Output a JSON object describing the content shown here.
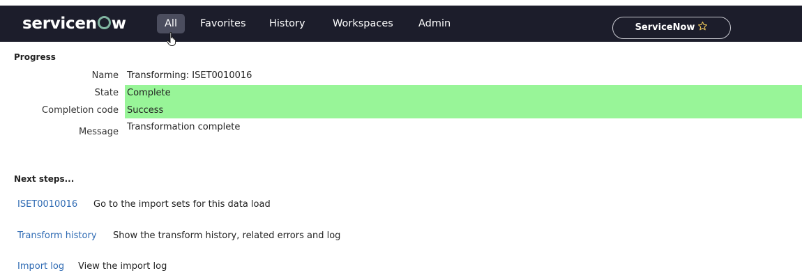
{
  "navbar": {
    "logo_text_pre": "servicen",
    "logo_text_post": "w",
    "items": [
      {
        "label": "All"
      },
      {
        "label": "Favorites"
      },
      {
        "label": "History"
      },
      {
        "label": "Workspaces"
      },
      {
        "label": "Admin"
      }
    ],
    "instance_label": "ServiceNow",
    "instance_icon": "star-icon",
    "colors": {
      "background": "#1c1d2b",
      "active_item": "#4b4d5e",
      "logo_accent": "#81b5a1"
    }
  },
  "progress": {
    "title": "Progress",
    "rows": [
      {
        "label": "Name",
        "value": "Transforming: ISET0010016"
      },
      {
        "label": "State",
        "value": "Complete",
        "highlight": "#98f598"
      },
      {
        "label": "Completion code",
        "value": "Success",
        "highlight": "#98f598"
      },
      {
        "label": "Message",
        "value": "Transformation complete"
      }
    ]
  },
  "next_steps": {
    "title": "Next steps...",
    "items": [
      {
        "link": "ISET0010016",
        "description": "Go to the import sets for this data load"
      },
      {
        "link": "Transform history",
        "description": "Show the transform history, related errors and log"
      },
      {
        "link": "Import log",
        "description": "View the import log"
      }
    ],
    "link_color": "#2e6ab3"
  }
}
